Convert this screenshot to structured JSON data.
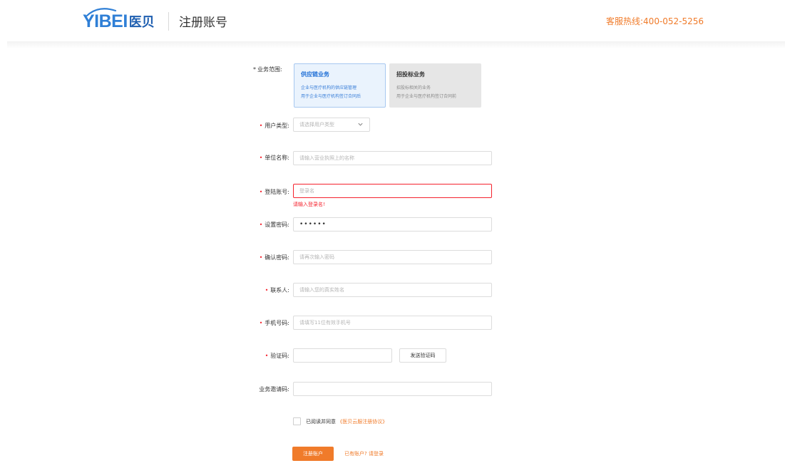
{
  "header": {
    "logo_en": "YIBEI",
    "logo_cn": "医贝",
    "page_title": "注册账号",
    "hotline": "客服热线:400-052-5256"
  },
  "form": {
    "business_scope": {
      "label": "业务范围:",
      "options": [
        {
          "title": "供应链业务",
          "desc1": "企业与医疗机构的供应链管理",
          "desc2": "用于企业与医疗机构签订合同后",
          "selected": true
        },
        {
          "title": "招投标业务",
          "desc1": "招投标相关的业务",
          "desc2": "用于企业与医疗机构签订合同前",
          "selected": false
        }
      ]
    },
    "user_type": {
      "label": "用户类型:",
      "placeholder": "请选择用户类型"
    },
    "org_name": {
      "label": "单位名称:",
      "placeholder": "请输入营业执照上的名称"
    },
    "login_account": {
      "label": "登陆账号:",
      "placeholder": "登录名",
      "error": "请输入登录名!"
    },
    "password": {
      "label": "设置密码:",
      "value": "••••••"
    },
    "confirm_password": {
      "label": "确认密码:",
      "placeholder": "请再次输入密码"
    },
    "contact": {
      "label": "联系人:",
      "placeholder": "请输入您的真实姓名"
    },
    "phone": {
      "label": "手机号码:",
      "placeholder": "请填写11位有效手机号"
    },
    "captcha": {
      "label": "验证码:",
      "placeholder": "",
      "send_label": "发送验证码"
    },
    "invite_code": {
      "label": "业务邀请码:",
      "placeholder": ""
    },
    "agreement": {
      "prefix": "已阅读并同意",
      "link": "《医贝云服注册协议》",
      "checked": false
    },
    "submit_label": "注册账户",
    "login_prompt": "已有账户? 请登录"
  },
  "colors": {
    "accent": "#f07b2a",
    "primary_blue": "#2f7fd6",
    "error": "#f5222d"
  }
}
